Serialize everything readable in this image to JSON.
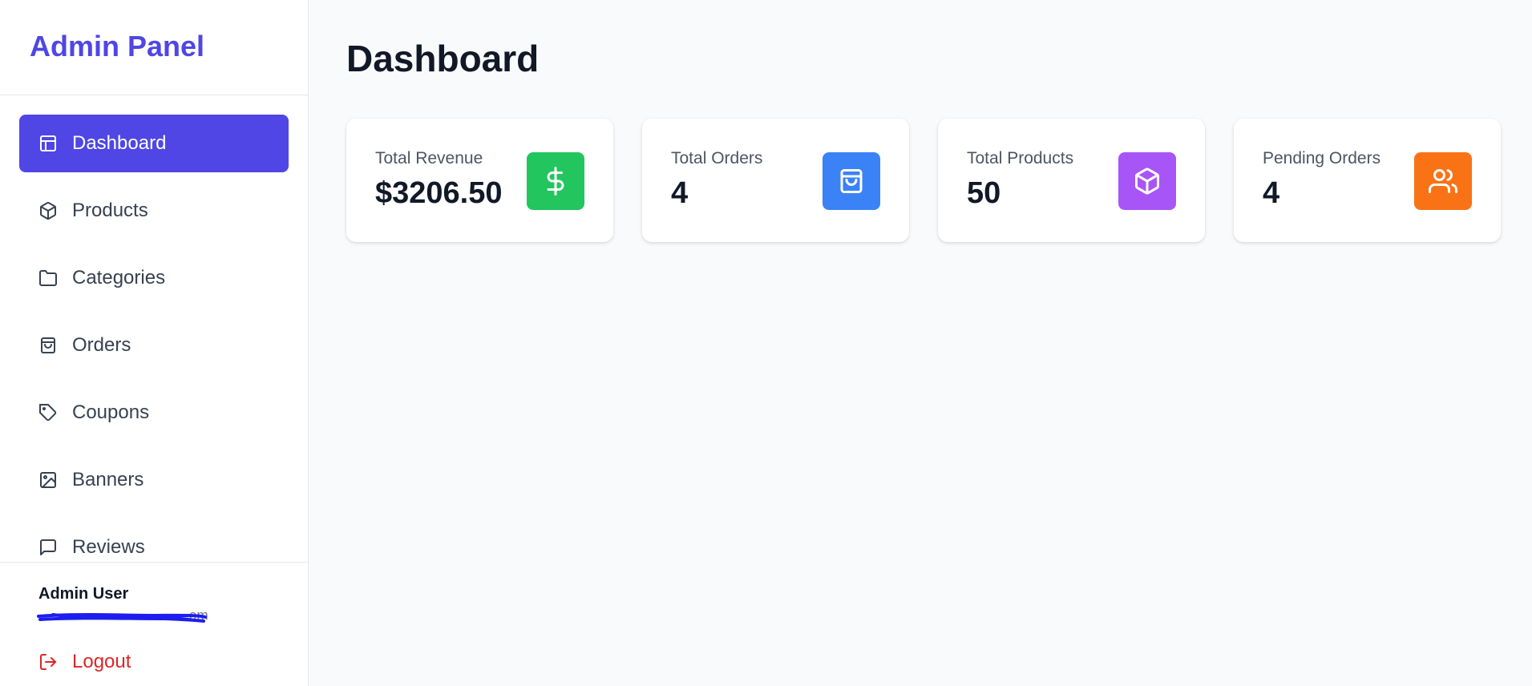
{
  "sidebar": {
    "brand": "Admin Panel",
    "items": [
      {
        "label": "Dashboard",
        "icon": "dashboard-icon",
        "active": true
      },
      {
        "label": "Products",
        "icon": "package-icon",
        "active": false
      },
      {
        "label": "Categories",
        "icon": "folder-icon",
        "active": false
      },
      {
        "label": "Orders",
        "icon": "shopping-bag-icon",
        "active": false
      },
      {
        "label": "Coupons",
        "icon": "tag-icon",
        "active": false
      },
      {
        "label": "Banners",
        "icon": "image-icon",
        "active": false
      },
      {
        "label": "Reviews",
        "icon": "message-icon",
        "active": false
      }
    ],
    "user": {
      "name": "Admin User",
      "email_tail": "om"
    },
    "logout_label": "Logout"
  },
  "main": {
    "title": "Dashboard",
    "cards": [
      {
        "label": "Total Revenue",
        "value": "$3206.50",
        "icon": "dollar-icon",
        "color": "#22c55e"
      },
      {
        "label": "Total Orders",
        "value": "4",
        "icon": "shopping-bag-icon",
        "color": "#3b82f6"
      },
      {
        "label": "Total Products",
        "value": "50",
        "icon": "package-icon",
        "color": "#a855f7"
      },
      {
        "label": "Pending Orders",
        "value": "4",
        "icon": "users-icon",
        "color": "#f97316"
      }
    ]
  },
  "colors": {
    "accent": "#4f46e5",
    "logout": "#dc2626",
    "background": "#f9fafb"
  }
}
